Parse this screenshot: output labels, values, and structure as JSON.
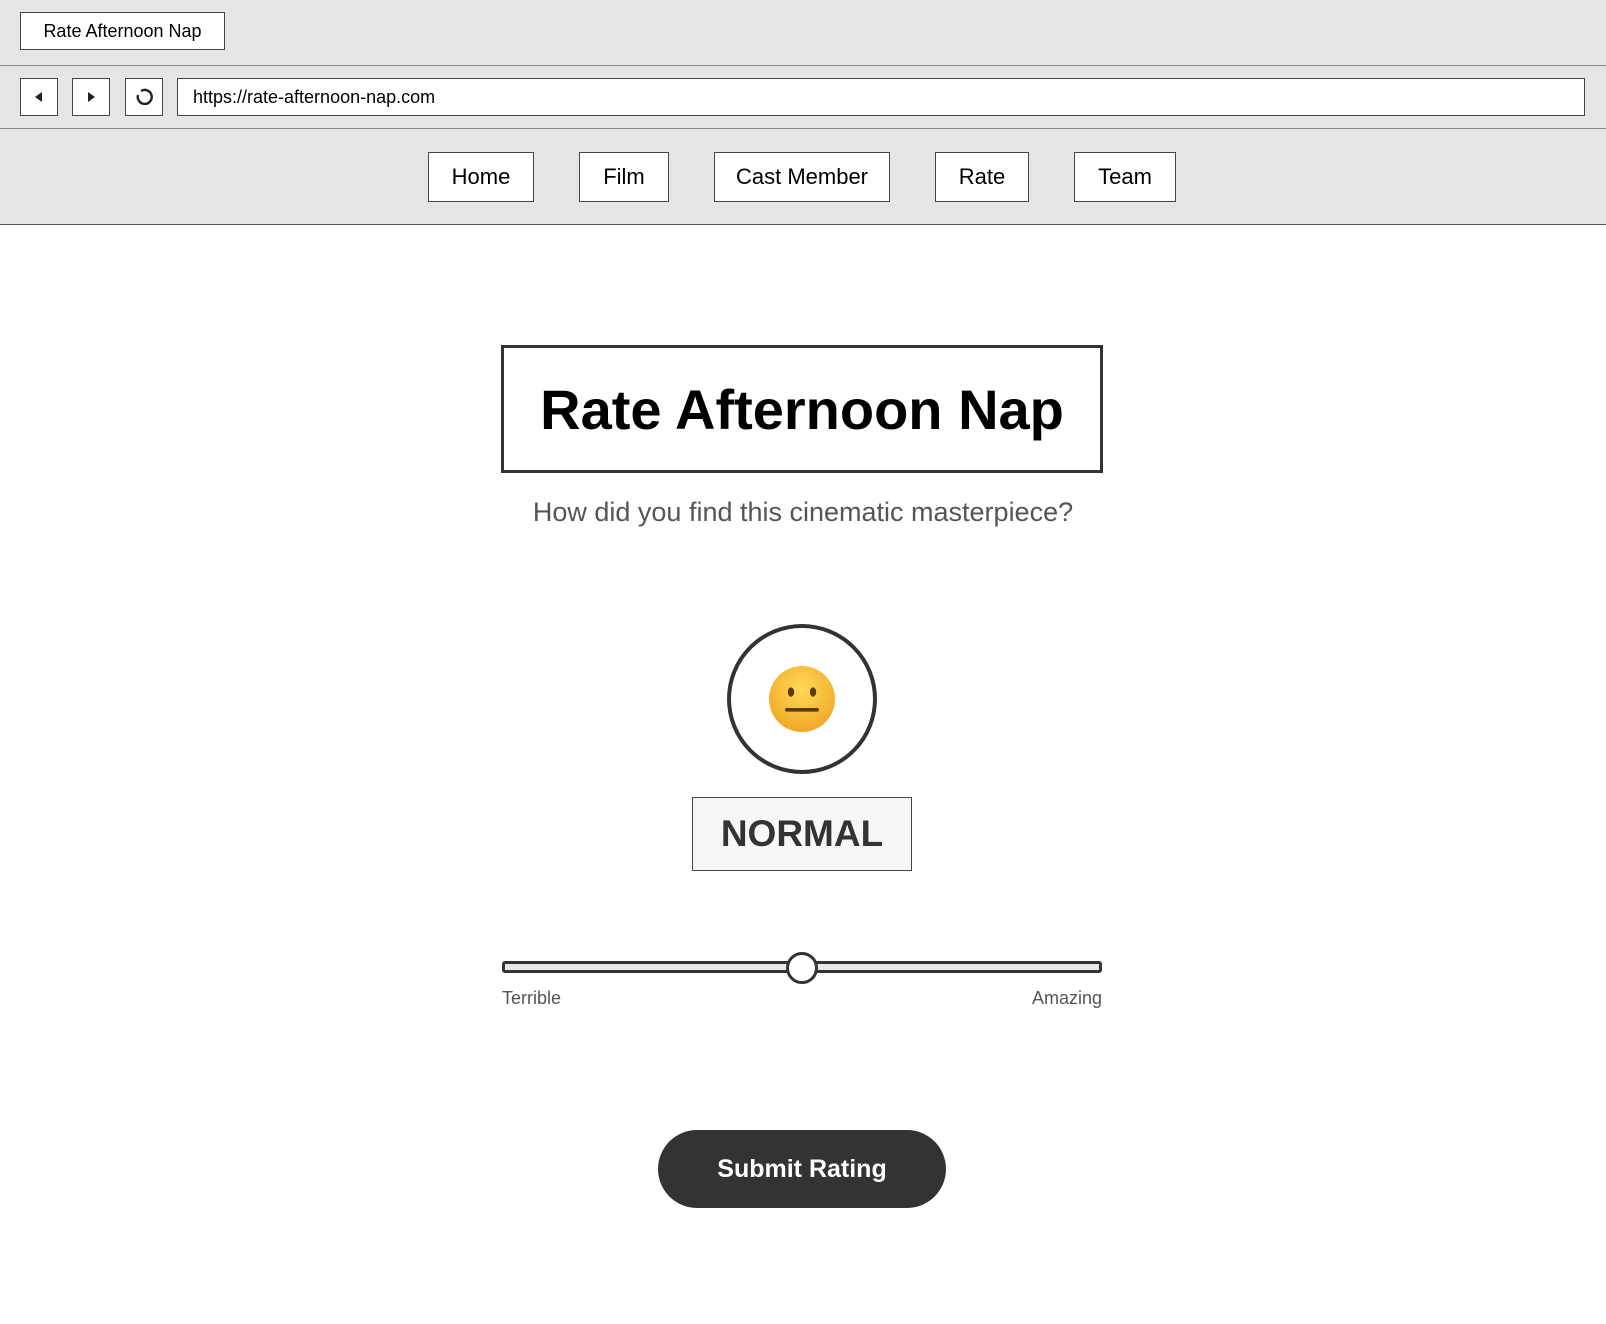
{
  "browser": {
    "tab_title": "Rate Afternoon Nap",
    "url": "https://rate-afternoon-nap.com",
    "back_icon": "back-arrow-icon",
    "forward_icon": "forward-arrow-icon",
    "reload_icon": "reload-icon"
  },
  "nav": {
    "items": [
      {
        "label": "Home"
      },
      {
        "label": "Film"
      },
      {
        "label": "Cast Member"
      },
      {
        "label": "Rate"
      },
      {
        "label": "Team"
      }
    ]
  },
  "main": {
    "title": "Rate Afternoon Nap",
    "subtitle": "How did you find this cinematic masterpiece?",
    "emoji": "neutral-face-emoji",
    "rating_label": "NORMAL",
    "slider": {
      "value": 0.5,
      "min_label": "Terrible",
      "max_label": "Amazing"
    },
    "submit_label": "Submit Rating"
  },
  "colors": {
    "chrome_bg": "#e5e5e5",
    "border": "#333333",
    "button_dark": "#333333",
    "subtitle_text": "#555555",
    "emoji_yellow": "#f5c242"
  }
}
